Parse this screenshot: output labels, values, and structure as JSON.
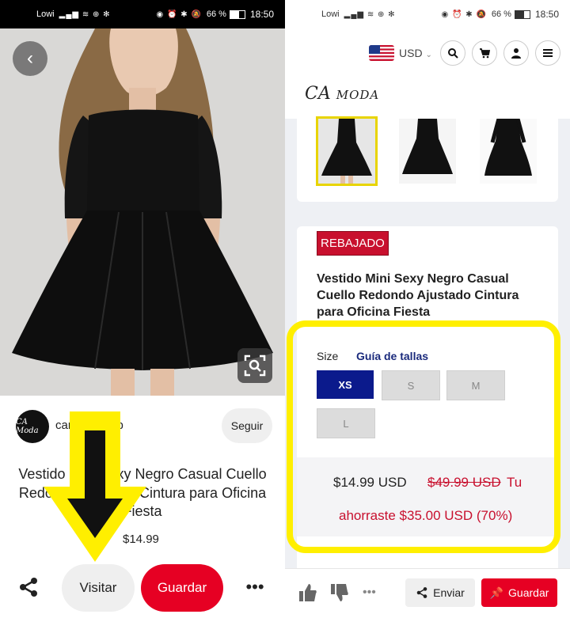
{
  "left": {
    "status": {
      "carrier": "Lowi",
      "battery": "66 %",
      "time": "18:50"
    },
    "source": {
      "avatar_text": "CA Moda",
      "name": "camodashop"
    },
    "follow_label": "Seguir",
    "title": "Vestido Mini Sexy Negro Casual Cuello Redondo Ajustado Cintura para Oficina Fiesta",
    "price": "$14.99",
    "actions": {
      "visit": "Visitar",
      "save": "Guardar"
    },
    "icons": [
      "back-chevron-icon",
      "visual-search-icon",
      "share-icon",
      "more-icon"
    ],
    "arrow_color": "#ffef00"
  },
  "right": {
    "status": {
      "carrier": "Lowi",
      "battery": "66 %",
      "time": "18:50"
    },
    "currency": "USD",
    "logo_main": "CA",
    "logo_sub": "MODA",
    "badge": "REBAJADO",
    "title": "Vestido Mini Sexy Negro Casual Cuello Redondo Ajustado Cintura para Oficina Fiesta",
    "size_label": "Size",
    "size_guide": "Guía de tallas",
    "sizes": [
      "XS",
      "S",
      "M",
      "L"
    ],
    "selected_size": "XS",
    "price_now": "$14.99 USD",
    "price_was": "$49.99 USD",
    "savings_line1": "Tu",
    "savings_line2": "ahorraste $35.00 USD (70%)",
    "actions": {
      "send": "Enviar",
      "save": "Guardar"
    },
    "icons": [
      "search-icon",
      "cart-icon",
      "user-icon",
      "menu-icon",
      "thumbs-up-icon",
      "thumbs-down-icon",
      "more-icon",
      "share-icon",
      "pin-icon"
    ],
    "highlight_color": "#ffef00"
  }
}
